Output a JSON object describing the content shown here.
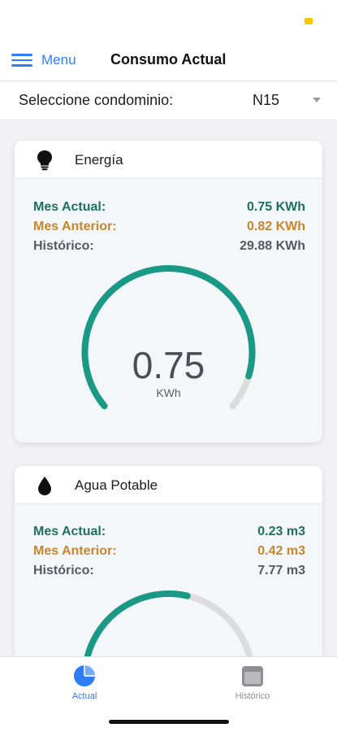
{
  "nav": {
    "menu_label": "Menu",
    "title": "Consumo Actual"
  },
  "selector": {
    "label": "Seleccione condominio:",
    "value": "N15"
  },
  "colors": {
    "accent": "#2f7df6",
    "gauge_fill": "#1a9a86",
    "gauge_track": "#dcdcdc",
    "current": "#1f6f5e",
    "previous": "#c7862b",
    "history": "#555a60"
  },
  "cards": {
    "energy": {
      "icon": "lightbulb-icon",
      "title": "Energía",
      "current_label": "Mes Actual:",
      "current_value": "0.75 KWh",
      "previous_label": "Mes Anterior:",
      "previous_value": "0.82 KWh",
      "history_label": "Histórico:",
      "history_value": "29.88 KWh",
      "gauge_value": "0.75",
      "gauge_unit": "KWh",
      "gauge_fraction": 0.91
    },
    "water": {
      "icon": "water-drop-icon",
      "title": "Agua Potable",
      "current_label": "Mes Actual:",
      "current_value": "0.23 m3",
      "previous_label": "Mes Anterior:",
      "previous_value": "0.42 m3",
      "history_label": "Histórico:",
      "history_value": "7.77 m3",
      "gauge_fraction": 0.55
    }
  },
  "tabs": {
    "actual": {
      "label": "Actual",
      "icon": "pie-chart-icon"
    },
    "historico": {
      "label": "Histórico",
      "icon": "calendar-icon"
    }
  }
}
